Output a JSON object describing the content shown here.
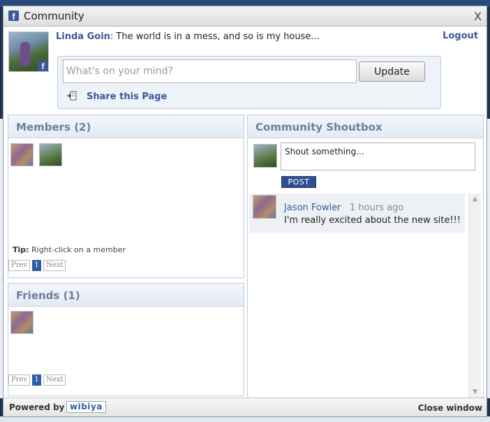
{
  "window": {
    "title": "Community",
    "close_label": "X"
  },
  "user": {
    "name": "Linda Goin",
    "status": ": The world is in a mess, and so is my house..."
  },
  "header": {
    "logout_label": "Logout"
  },
  "status_box": {
    "placeholder": "What's on your mind?",
    "update_label": "Update",
    "share_label": "Share this Page"
  },
  "members": {
    "title": "Members (2)",
    "tip_label": "Tip:",
    "tip_text": " Right-click on a member",
    "pager": {
      "prev": "Prev",
      "page": "1",
      "next": "Next"
    }
  },
  "friends": {
    "title": "Friends (1)",
    "pager": {
      "prev": "Prev",
      "page": "1",
      "next": "Next"
    }
  },
  "shoutbox": {
    "title": "Community Shoutbox",
    "placeholder": "Shout something...",
    "post_label": "POST",
    "messages": [
      {
        "author": "Jason Fowler",
        "time": "1 hours ago",
        "text": "I'm really excited about the new site!!!"
      }
    ]
  },
  "footer": {
    "powered_by": "Powered by",
    "brand": "wibiya",
    "close_label": "Close window"
  },
  "colors": {
    "accent": "#3b5998",
    "panel_header_text": "#6c7f99"
  }
}
